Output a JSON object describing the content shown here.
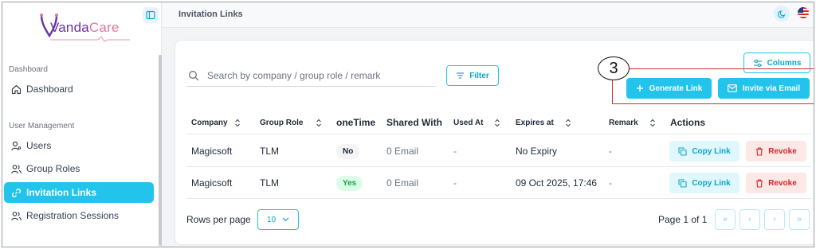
{
  "app": {
    "logo_vanda": "Vanda",
    "logo_care": "Care",
    "brand_colors": {
      "primary": "#22c4ec",
      "logo_purple": "#6b2fa6",
      "logo_pink": "#e0779f",
      "danger": "#dc2626",
      "success": "#16a34a"
    }
  },
  "sidebar": {
    "sections": [
      {
        "label": "Dashboard",
        "items": [
          {
            "label": "Dashboard",
            "icon": "home-icon"
          }
        ]
      },
      {
        "label": "User Management",
        "items": [
          {
            "label": "Users",
            "icon": "user-key-icon"
          },
          {
            "label": "Group Roles",
            "icon": "users-icon"
          },
          {
            "label": "Invitation Links",
            "icon": "link-icon",
            "active": true
          },
          {
            "label": "Registration Sessions",
            "icon": "users-icon"
          }
        ]
      }
    ]
  },
  "header": {
    "title": "Invitation Links",
    "theme_icon": "moon-icon",
    "language_icon": "us-flag-icon"
  },
  "toolbar": {
    "search_placeholder": "Search by company / group role / remark",
    "filter_label": "Filter",
    "columns_label": "Columns",
    "generate_label": "Generate Link",
    "invite_label": "Invite via Email",
    "step_number": "3"
  },
  "table": {
    "headers": {
      "company": "Company",
      "group_role": "Group Role",
      "onetime": "oneTime",
      "shared_with": "Shared With",
      "used_at": "Used At",
      "expires_at": "Expires at",
      "remark": "Remark",
      "actions": "Actions"
    },
    "rows": [
      {
        "company": "Magicsoft",
        "group_role": "TLM",
        "onetime": "No",
        "shared_with": "0 Email",
        "used_at": "-",
        "expires_at": "No Expiry",
        "remark": "-",
        "copy_label": "Copy Link",
        "revoke_label": "Revoke"
      },
      {
        "company": "Magicsoft",
        "group_role": "TLM",
        "onetime": "Yes",
        "shared_with": "0 Email",
        "used_at": "-",
        "expires_at": "09 Oct 2025, 17:46",
        "remark": "-",
        "copy_label": "Copy Link",
        "revoke_label": "Revoke"
      }
    ]
  },
  "pagination": {
    "rows_per_page_label": "Rows per page",
    "rows_per_page_value": "10",
    "page_info": "Page 1 of 1",
    "first": "«",
    "prev": "‹",
    "next": "›",
    "last": "»"
  }
}
